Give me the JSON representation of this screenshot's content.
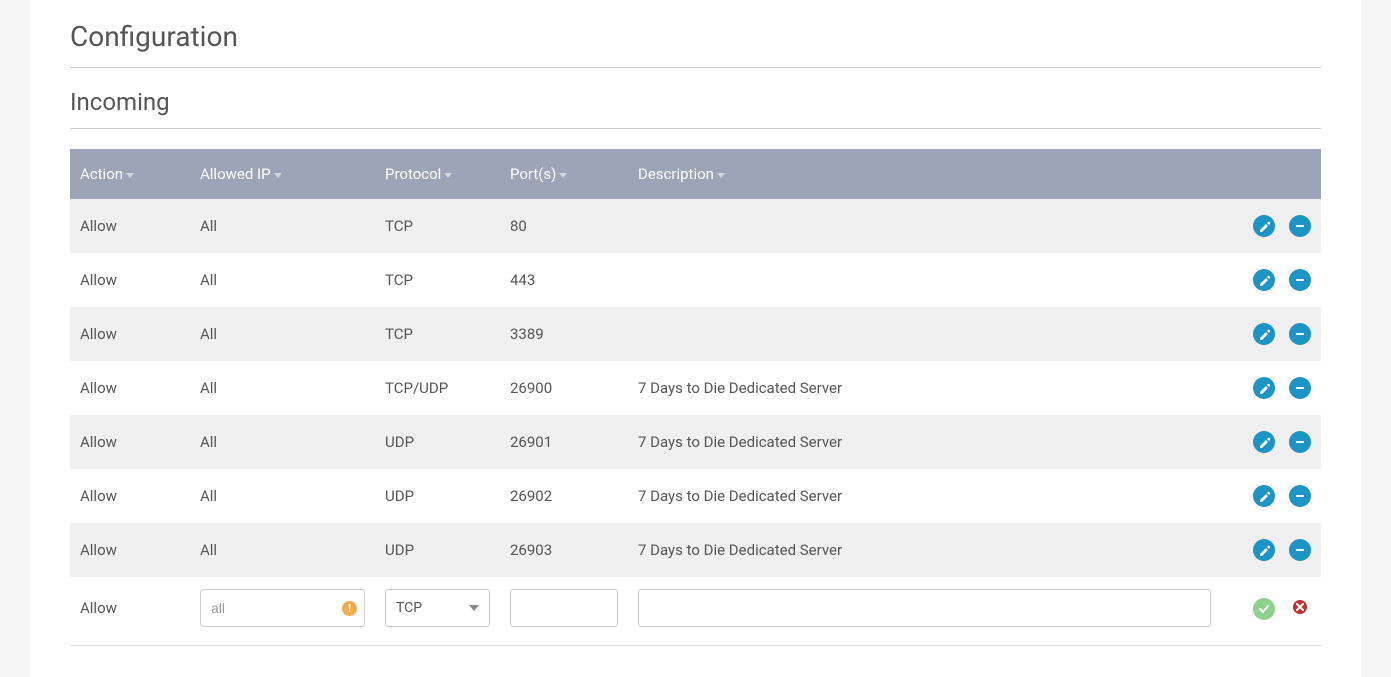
{
  "section_title": "Configuration",
  "sub_title": "Incoming",
  "columns": {
    "action": "Action",
    "allowed_ip": "Allowed IP",
    "protocol": "Protocol",
    "ports": "Port(s)",
    "description": "Description"
  },
  "rows": [
    {
      "action": "Allow",
      "allowed_ip": "All",
      "protocol": "TCP",
      "ports": "80",
      "description": ""
    },
    {
      "action": "Allow",
      "allowed_ip": "All",
      "protocol": "TCP",
      "ports": "443",
      "description": ""
    },
    {
      "action": "Allow",
      "allowed_ip": "All",
      "protocol": "TCP",
      "ports": "3389",
      "description": ""
    },
    {
      "action": "Allow",
      "allowed_ip": "All",
      "protocol": "TCP/UDP",
      "ports": "26900",
      "description": "7 Days to Die Dedicated Server"
    },
    {
      "action": "Allow",
      "allowed_ip": "All",
      "protocol": "UDP",
      "ports": "26901",
      "description": "7 Days to Die Dedicated Server"
    },
    {
      "action": "Allow",
      "allowed_ip": "All",
      "protocol": "UDP",
      "ports": "26902",
      "description": "7 Days to Die Dedicated Server"
    },
    {
      "action": "Allow",
      "allowed_ip": "All",
      "protocol": "UDP",
      "ports": "26903",
      "description": "7 Days to Die Dedicated Server"
    }
  ],
  "new_row": {
    "action": "Allow",
    "allowed_ip_value": "all",
    "protocol_value": "TCP",
    "ports_value": "",
    "description_value": ""
  },
  "icons": {
    "edit": "edit-icon",
    "remove": "remove-icon",
    "confirm": "check-icon",
    "cancel": "x-icon",
    "warn": "!"
  },
  "colors": {
    "header_bg": "#9ba5b7",
    "accent": "#1c94c4",
    "confirm": "#8ed08e",
    "cancel": "#c23030",
    "warn": "#f0ad4e"
  }
}
